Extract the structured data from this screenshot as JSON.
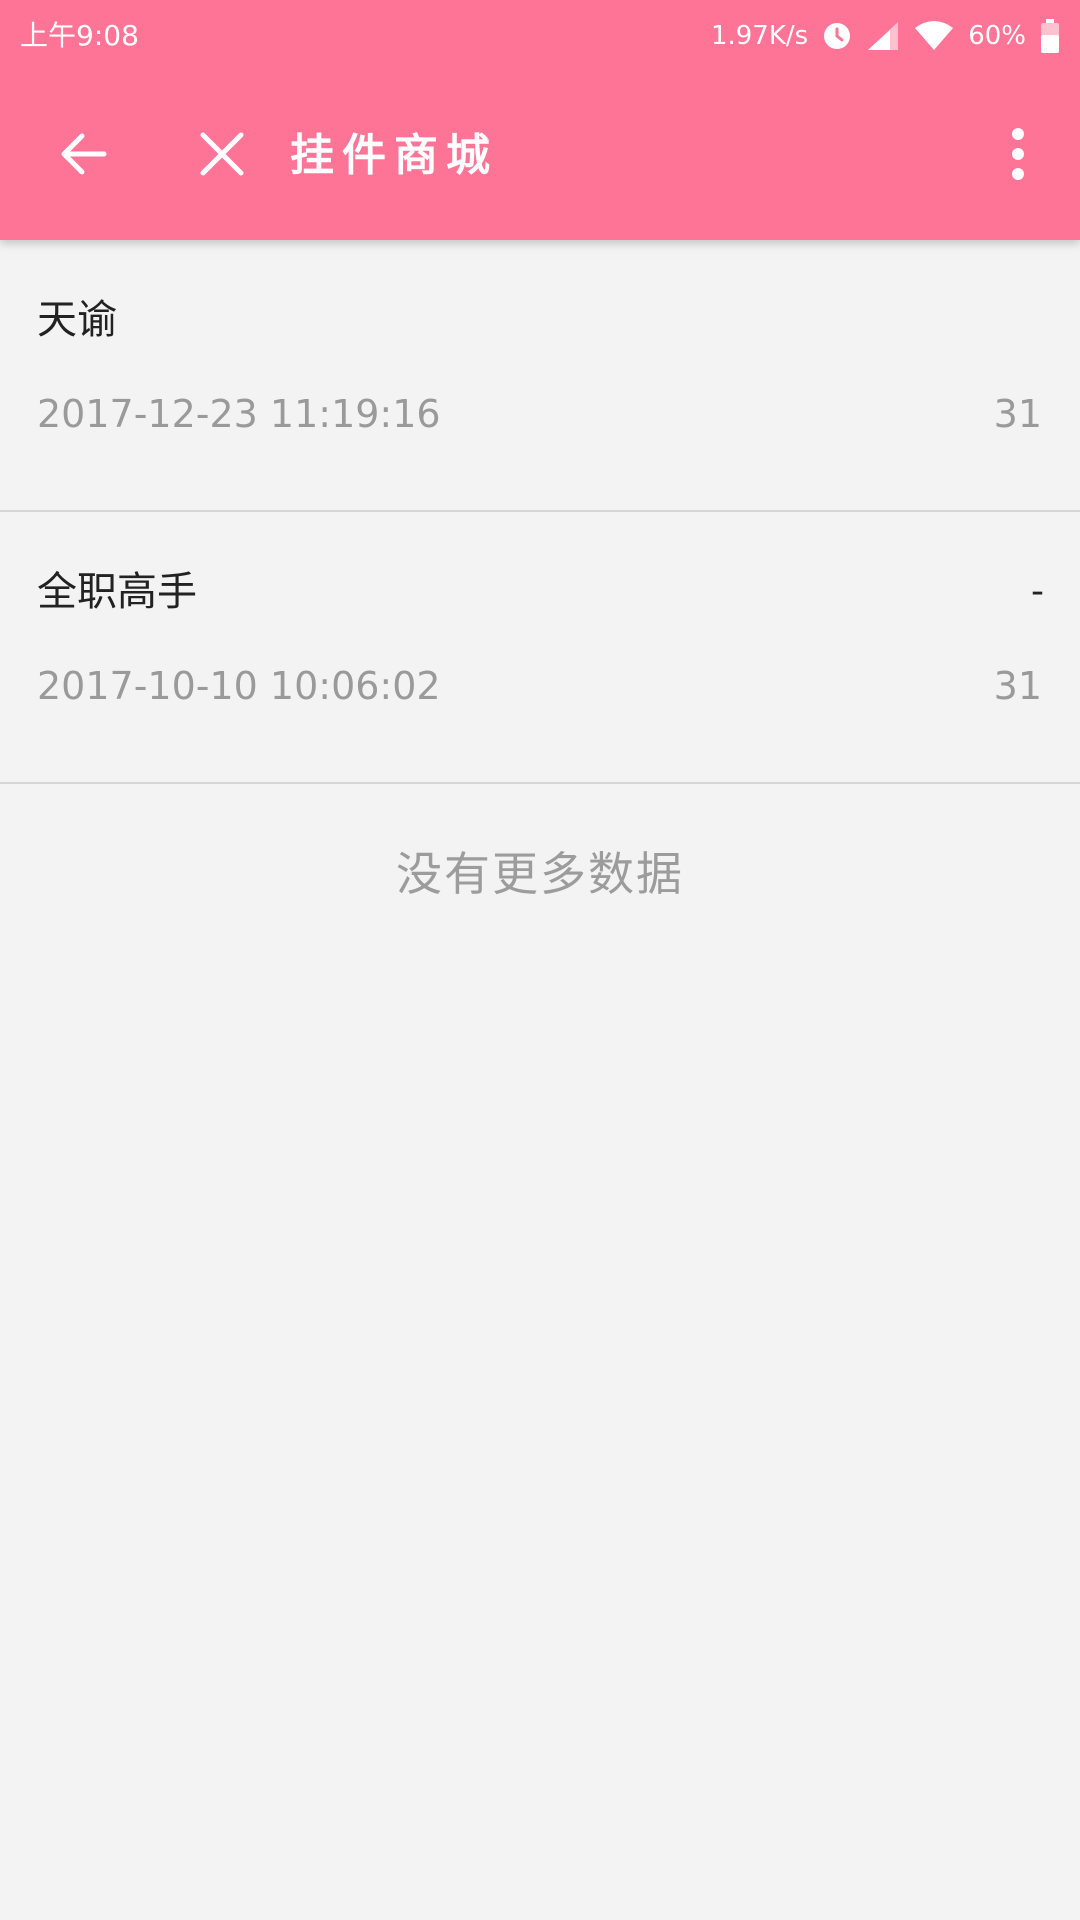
{
  "status_bar": {
    "time": "上午9:08",
    "net_speed": "1.97K/s",
    "battery": "60%"
  },
  "toolbar": {
    "title": "挂件商城",
    "back_icon": "arrow-left-icon",
    "close_icon": "close-icon",
    "more_icon": "more-vert-icon"
  },
  "items": [
    {
      "name": "天谕",
      "extra": "",
      "date": "2017-12-23 11:19:16",
      "count": "31"
    },
    {
      "name": "全职高手",
      "extra": "-",
      "date": "2017-10-10 10:06:02",
      "count": "31"
    }
  ],
  "footer": {
    "no_more": "没有更多数据"
  },
  "colors": {
    "accent": "#fe7497",
    "background": "#f3f3f3",
    "primary_text": "#222222",
    "secondary_text": "#9a9a9a"
  }
}
